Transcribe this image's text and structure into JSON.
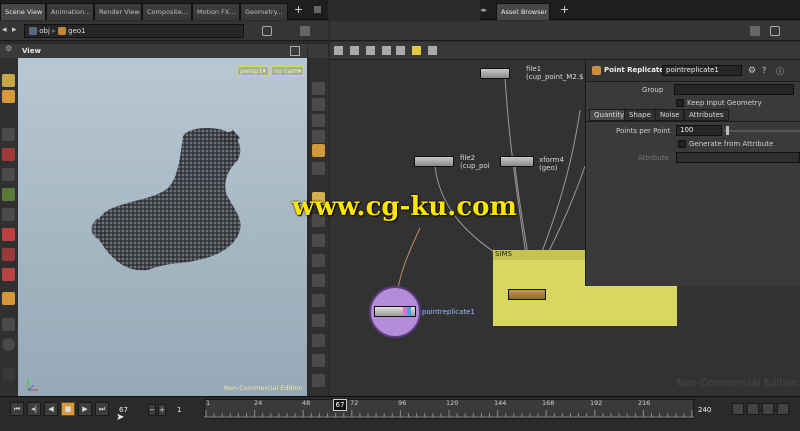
{
  "left_tabs": [
    "Scene View",
    "Animation...",
    "Render View",
    "Composite...",
    "Motion FX...",
    "Geometry..."
  ],
  "right_tabs": [
    "Asset Browser"
  ],
  "left_path": {
    "root": "obj",
    "node": "geo1"
  },
  "viewport": {
    "title": "View",
    "camera": "persp1▾",
    "cam_select": "no cam▾",
    "noncommercial": "Non-Commercial Edition"
  },
  "network": {
    "nodes": {
      "file1": {
        "name": "file1",
        "sub": "(cup_point_M2.$"
      },
      "file2": {
        "name": "file2",
        "sub": "(cup_poi"
      },
      "xform": {
        "name": "xform4",
        "sub": "(geo)"
      },
      "sims": {
        "name": "SIMS"
      },
      "pointreplicate": {
        "name": "pointreplicate1"
      }
    },
    "noncommercial": "Non-Commercial Edition"
  },
  "params": {
    "op_type": "Point Replicate",
    "op_name": "pointreplicate1",
    "group_label": "Group",
    "keep_input_label": "Keep Input Geometry",
    "tabs": [
      "Quantity",
      "Shape",
      "Noise",
      "Attributes"
    ],
    "points_per_point_label": "Points per Point",
    "points_per_point_value": "100",
    "generate_attr_label": "Generate from Attribute",
    "attribute_label": "Attribute"
  },
  "watermark": "www.cg-ku.com",
  "timeline": {
    "current_frame": "67",
    "step": "1",
    "end_frame": "240",
    "ticks": [
      "1",
      "24",
      "48",
      "72",
      "96",
      "120",
      "144",
      "168",
      "192",
      "216"
    ],
    "marker": "67"
  },
  "colors": {
    "sims_box": "#d8d860",
    "selected_circle": "#b48cd8",
    "watermark": "#ffe600"
  }
}
